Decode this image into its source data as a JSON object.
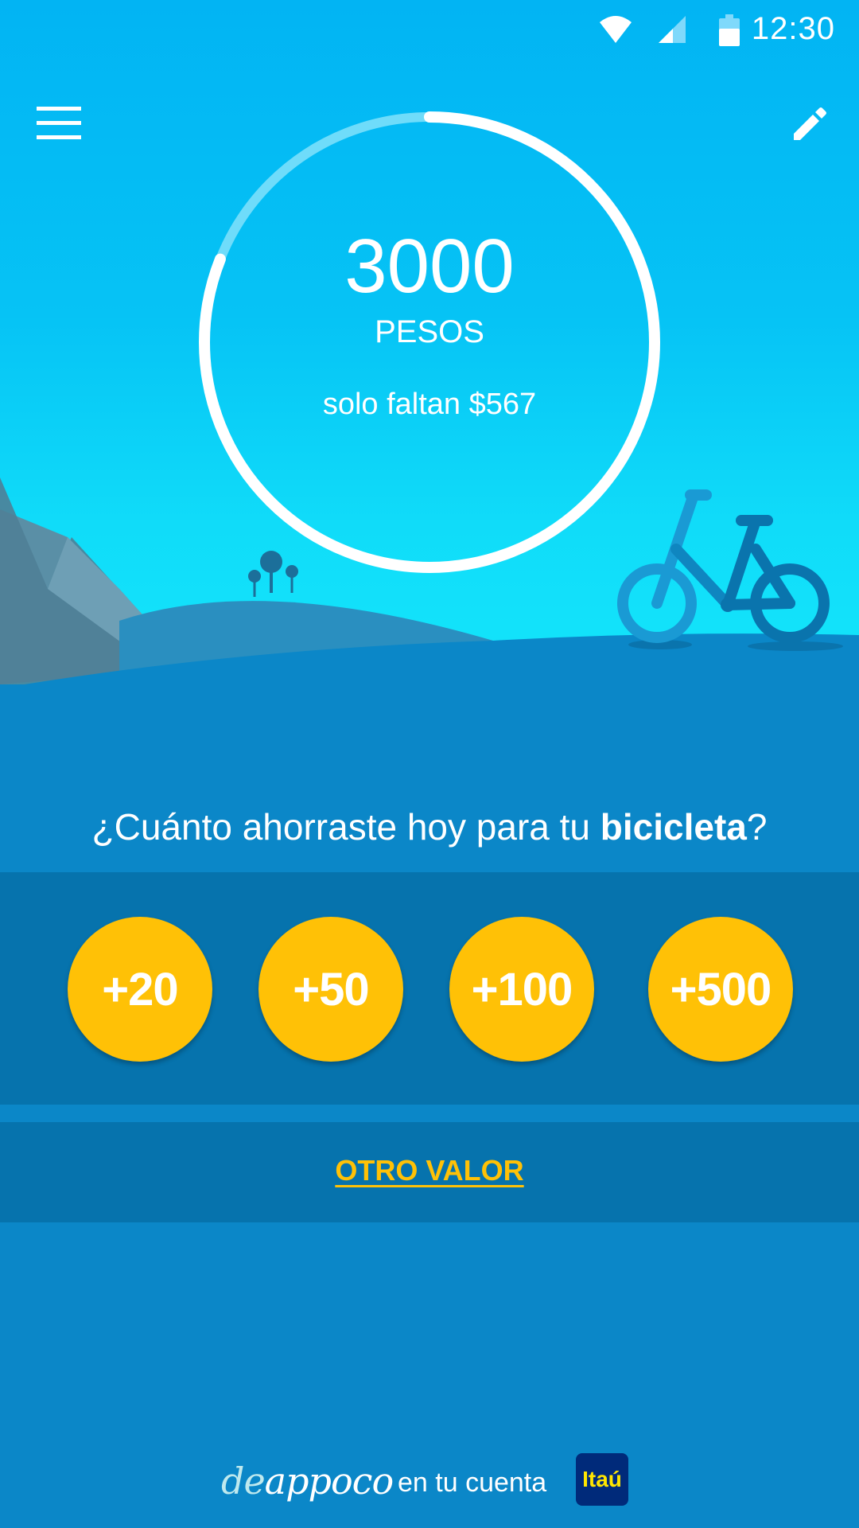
{
  "status_bar": {
    "time": "12:30",
    "icons": [
      "wifi-icon",
      "signal-icon",
      "battery-icon"
    ]
  },
  "toolbar": {
    "menu_icon": "menu-icon",
    "edit_icon": "pencil-icon"
  },
  "goal": {
    "amount": "3000",
    "unit": "PESOS",
    "remaining": "solo faltan $567",
    "progress_fraction": 0.81
  },
  "question": {
    "prefix": "¿Cuánto ahorraste hoy para tu ",
    "highlight": "bicicleta",
    "suffix": "?"
  },
  "amount_buttons": [
    "+20",
    "+50",
    "+100",
    "+500"
  ],
  "other_value": "OTRO VALOR",
  "footer": {
    "brand_de": "de",
    "brand_rest": "appoco",
    "text": "en tu cuenta",
    "bank": "Itaú"
  },
  "colors": {
    "sky": "#02b4f3",
    "ground": "#0b87c8",
    "band": "#0673ad",
    "accent": "#ffc106"
  }
}
